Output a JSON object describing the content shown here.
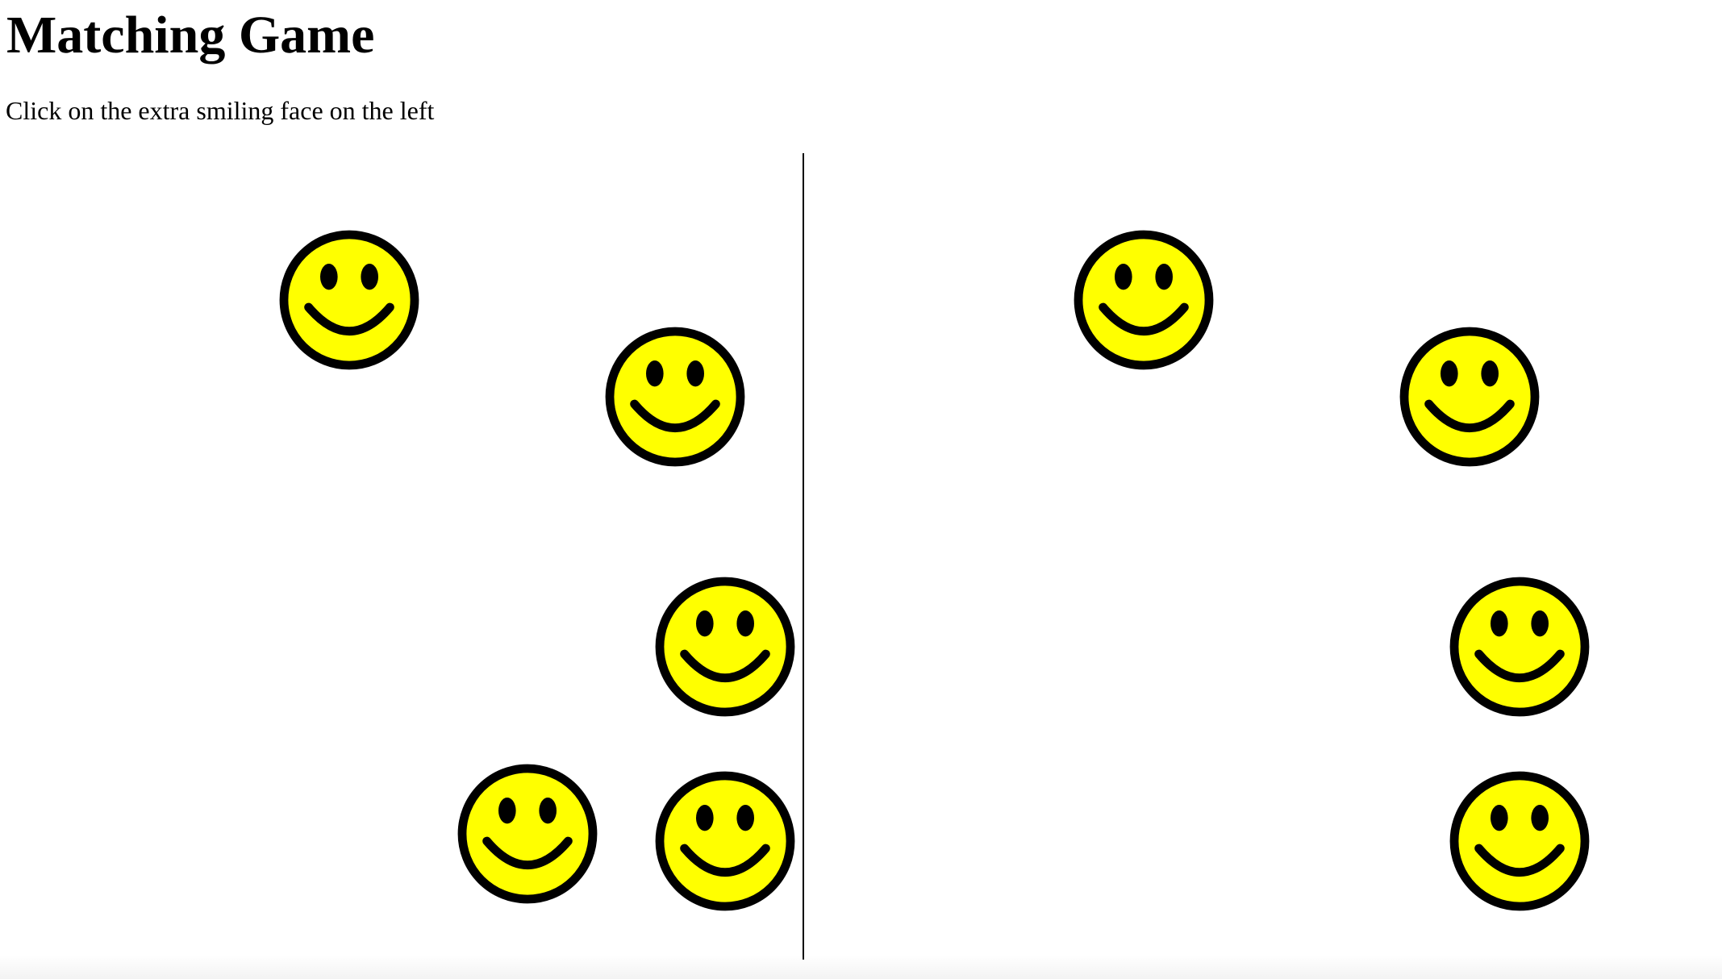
{
  "page": {
    "title": "Matching Game",
    "instructions": "Click on the extra smiling face on the left"
  },
  "colors": {
    "face_fill": "#ffff00",
    "face_outline": "#000000",
    "divider": "#000000",
    "background": "#ffffff"
  },
  "icons": {
    "face": "smiley-face-icon"
  },
  "board": {
    "left_face_count": 5,
    "right_face_count": 4
  }
}
